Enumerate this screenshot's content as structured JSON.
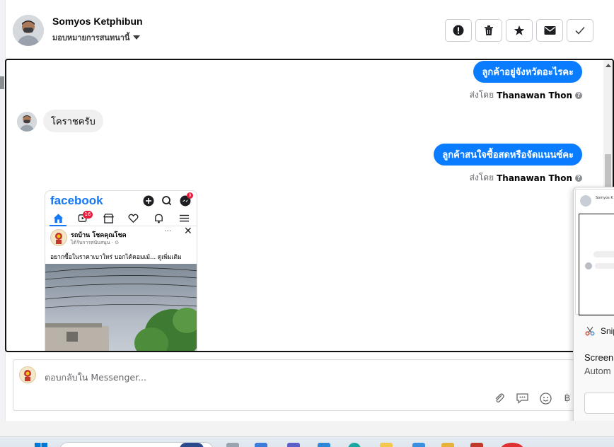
{
  "header": {
    "name": "Somyos Ketphibun",
    "assign_label": "มอบหมายการสนทนานี้"
  },
  "messages": [
    {
      "direction": "out",
      "text": "ลูกค้าอยู่จังหวัดอะไรคะ",
      "sent_by_prefix": "ส่งโดย",
      "sent_by_name": "Thanawan Thon"
    },
    {
      "direction": "in",
      "text": "โคราชครับ"
    },
    {
      "direction": "out",
      "text": "ลูกค้าสนใจซื้อสดหรือจัดแนนซ์คะ",
      "sent_by_prefix": "ส่งโดย",
      "sent_by_name": "Thanawan Thon"
    }
  ],
  "shared_screenshot": {
    "app_logo": "facebook",
    "notification_badge": "16",
    "messenger_badge": "9",
    "post_author": "รถบ้าน โชคคุณโชค",
    "post_subtitle": "ได้รับการสนับสนุน · ⊙",
    "post_text": "อยากซื้อในราคาเบาใหร่ บอกได้คอมเม้... ดูเพิ่มเติม"
  },
  "composer": {
    "placeholder": "ตอบกลับใน Messenger..."
  },
  "snip_panel": {
    "thumb_name": "Somyos K",
    "title": "Snip",
    "line1": "Screen",
    "line2": "Autom"
  },
  "icons": {
    "report": "exclamation-circle-icon",
    "delete": "trash-icon",
    "star": "star-icon",
    "mail": "envelope-icon",
    "done": "check-icon",
    "attach": "paperclip-icon",
    "reply_template": "chat-bubble-icon",
    "emoji": "smiley-icon",
    "payment": "baht-icon"
  },
  "colors": {
    "outgoing_bubble": "#0a7cff",
    "incoming_bubble": "#f0f0f0",
    "facebook_blue": "#1877f2"
  }
}
